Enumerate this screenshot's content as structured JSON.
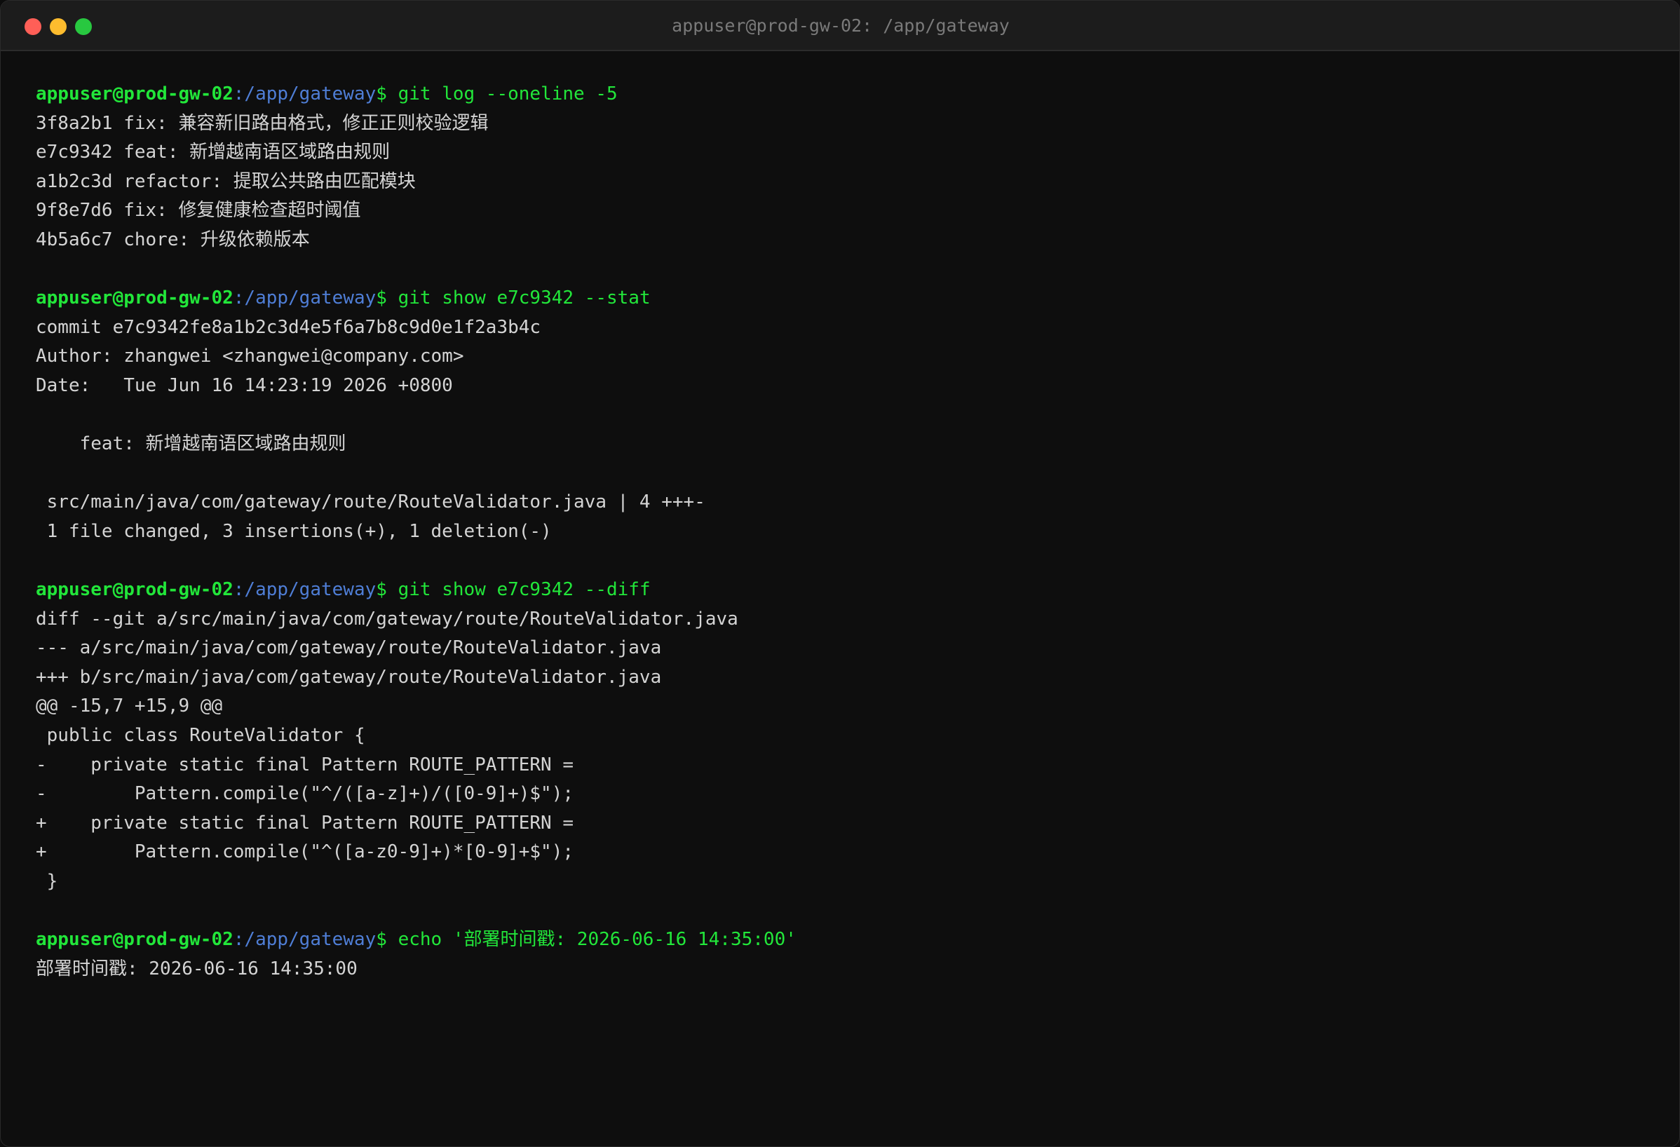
{
  "window": {
    "title": "appuser@prod-gw-02: /app/gateway"
  },
  "terminal": {
    "prompt": {
      "user_host": "appuser@prod-gw-02",
      "path": ":/app/gateway",
      "symbol": "$ "
    },
    "commands": [
      "git log --oneline -5",
      "git show e7c9342 --stat",
      "git show e7c9342 --diff",
      "echo '部署时间戳: 2026-06-16 14:35:00'"
    ],
    "log_output": [
      "3f8a2b1 fix: 兼容新旧路由格式，修正正则校验逻辑",
      "e7c9342 feat: 新增越南语区域路由规则",
      "a1b2c3d refactor: 提取公共路由匹配模块",
      "9f8e7d6 fix: 修复健康检查超时阈值",
      "4b5a6c7 chore: 升级依赖版本"
    ],
    "stat_output": [
      "commit e7c9342fe8a1b2c3d4e5f6a7b8c9d0e1f2a3b4c",
      "Author: zhangwei <zhangwei@company.com>",
      "Date:   Tue Jun 16 14:23:19 2026 +0800",
      "",
      "    feat: 新增越南语区域路由规则",
      "",
      " src/main/java/com/gateway/route/RouteValidator.java | 4 +++-",
      " 1 file changed, 3 insertions(+), 1 deletion(-)"
    ],
    "diff_output": [
      "diff --git a/src/main/java/com/gateway/route/RouteValidator.java",
      "--- a/src/main/java/com/gateway/route/RouteValidator.java",
      "+++ b/src/main/java/com/gateway/route/RouteValidator.java",
      "@@ -15,7 +15,9 @@",
      " public class RouteValidator {",
      "-    private static final Pattern ROUTE_PATTERN =",
      "-        Pattern.compile(\"^/([a-z]+)/([0-9]+)$\");",
      "+    private static final Pattern ROUTE_PATTERN =",
      "+        Pattern.compile(\"^([a-z0-9]+)*[0-9]+$\");",
      " }"
    ],
    "echo_output": [
      "部署时间戳: 2026-06-16 14:35:00"
    ]
  },
  "colors": {
    "prompt_user": "#22e63a",
    "prompt_path": "#4f7ed6",
    "output_text": "#d4d4d4",
    "background": "#0e0e0e",
    "titlebar": "#1c1c1c"
  }
}
